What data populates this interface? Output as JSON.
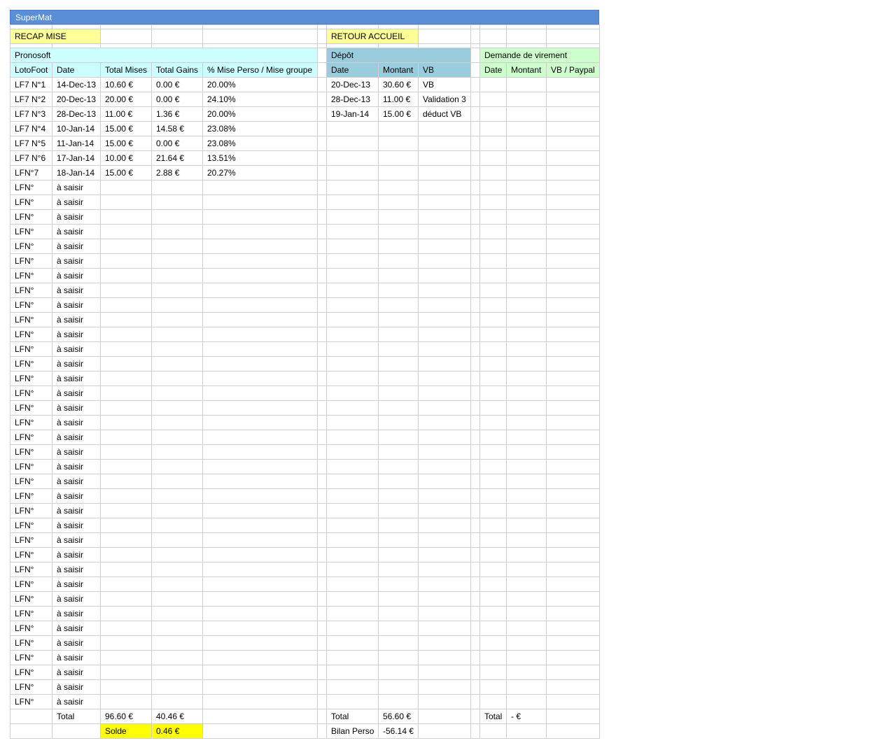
{
  "title": "SuperMat",
  "buttons": {
    "recap": "RECAP MISE",
    "retour": "RETOUR ACCUEIL"
  },
  "sections": {
    "pronosoft": "Pronosoft",
    "depot": "Dépôt",
    "virement": "Demande de virement"
  },
  "headers": {
    "pronosoft": [
      "LotoFoot",
      "Date",
      "Total Mises",
      "Total Gains",
      "% Mise Perso / Mise groupe"
    ],
    "depot": [
      "Date",
      "Montant",
      "VB"
    ],
    "virement": [
      "Date",
      "Montant",
      "VB / Paypal"
    ]
  },
  "rows": [
    {
      "lf": "LF7 N°1",
      "date": "14-Dec-13",
      "mises": "10.60 €",
      "gains": "0.00 €",
      "pct": "20.00%"
    },
    {
      "lf": "LF7 N°2",
      "date": "20-Dec-13",
      "mises": "20.00 €",
      "gains": "0.00 €",
      "pct": "24.10%"
    },
    {
      "lf": "LF7 N°3",
      "date": "28-Dec-13",
      "mises": "11.00 €",
      "gains": "1.36 €",
      "pct": "20.00%"
    },
    {
      "lf": "LF7 N°4",
      "date": "10-Jan-14",
      "mises": "15.00 €",
      "gains": "14.58 €",
      "pct": "23.08%"
    },
    {
      "lf": "LF7 N°5",
      "date": "11-Jan-14",
      "mises": "15.00 €",
      "gains": "0.00 €",
      "pct": "23.08%"
    },
    {
      "lf": "LF7 N°6",
      "date": "17-Jan-14",
      "mises": "10.00 €",
      "gains": "21.64 €",
      "pct": "13.51%"
    },
    {
      "lf": "LFN°7",
      "date": "18-Jan-14",
      "mises": "15.00 €",
      "gains": "2.88 €",
      "pct": "20.27%"
    },
    {
      "lf": "LFN°",
      "date": "à saisir",
      "mises": "",
      "gains": "",
      "pct": ""
    },
    {
      "lf": "LFN°",
      "date": "à saisir",
      "mises": "",
      "gains": "",
      "pct": ""
    },
    {
      "lf": "LFN°",
      "date": "à saisir",
      "mises": "",
      "gains": "",
      "pct": ""
    },
    {
      "lf": "LFN°",
      "date": "à saisir",
      "mises": "",
      "gains": "",
      "pct": ""
    },
    {
      "lf": "LFN°",
      "date": "à saisir",
      "mises": "",
      "gains": "",
      "pct": ""
    },
    {
      "lf": "LFN°",
      "date": "à saisir",
      "mises": "",
      "gains": "",
      "pct": ""
    },
    {
      "lf": "LFN°",
      "date": "à saisir",
      "mises": "",
      "gains": "",
      "pct": ""
    },
    {
      "lf": "LFN°",
      "date": "à saisir",
      "mises": "",
      "gains": "",
      "pct": ""
    },
    {
      "lf": "LFN°",
      "date": "à saisir",
      "mises": "",
      "gains": "",
      "pct": ""
    },
    {
      "lf": "LFN°",
      "date": "à saisir",
      "mises": "",
      "gains": "",
      "pct": ""
    },
    {
      "lf": "LFN°",
      "date": "à saisir",
      "mises": "",
      "gains": "",
      "pct": ""
    },
    {
      "lf": "LFN°",
      "date": "à saisir",
      "mises": "",
      "gains": "",
      "pct": ""
    },
    {
      "lf": "LFN°",
      "date": "à saisir",
      "mises": "",
      "gains": "",
      "pct": ""
    },
    {
      "lf": "LFN°",
      "date": "à saisir",
      "mises": "",
      "gains": "",
      "pct": ""
    },
    {
      "lf": "LFN°",
      "date": "à saisir",
      "mises": "",
      "gains": "",
      "pct": ""
    },
    {
      "lf": "LFN°",
      "date": "à saisir",
      "mises": "",
      "gains": "",
      "pct": ""
    },
    {
      "lf": "LFN°",
      "date": "à saisir",
      "mises": "",
      "gains": "",
      "pct": ""
    },
    {
      "lf": "LFN°",
      "date": "à saisir",
      "mises": "",
      "gains": "",
      "pct": ""
    },
    {
      "lf": "LFN°",
      "date": "à saisir",
      "mises": "",
      "gains": "",
      "pct": ""
    },
    {
      "lf": "LFN°",
      "date": "à saisir",
      "mises": "",
      "gains": "",
      "pct": ""
    },
    {
      "lf": "LFN°",
      "date": "à saisir",
      "mises": "",
      "gains": "",
      "pct": ""
    },
    {
      "lf": "LFN°",
      "date": "à saisir",
      "mises": "",
      "gains": "",
      "pct": ""
    },
    {
      "lf": "LFN°",
      "date": "à saisir",
      "mises": "",
      "gains": "",
      "pct": ""
    },
    {
      "lf": "LFN°",
      "date": "à saisir",
      "mises": "",
      "gains": "",
      "pct": ""
    },
    {
      "lf": "LFN°",
      "date": "à saisir",
      "mises": "",
      "gains": "",
      "pct": ""
    },
    {
      "lf": "LFN°",
      "date": "à saisir",
      "mises": "",
      "gains": "",
      "pct": ""
    },
    {
      "lf": "LFN°",
      "date": "à saisir",
      "mises": "",
      "gains": "",
      "pct": ""
    },
    {
      "lf": "LFN°",
      "date": "à saisir",
      "mises": "",
      "gains": "",
      "pct": ""
    },
    {
      "lf": "LFN°",
      "date": "à saisir",
      "mises": "",
      "gains": "",
      "pct": ""
    },
    {
      "lf": "LFN°",
      "date": "à saisir",
      "mises": "",
      "gains": "",
      "pct": ""
    },
    {
      "lf": "LFN°",
      "date": "à saisir",
      "mises": "",
      "gains": "",
      "pct": ""
    },
    {
      "lf": "LFN°",
      "date": "à saisir",
      "mises": "",
      "gains": "",
      "pct": ""
    },
    {
      "lf": "LFN°",
      "date": "à saisir",
      "mises": "",
      "gains": "",
      "pct": ""
    },
    {
      "lf": "LFN°",
      "date": "à saisir",
      "mises": "",
      "gains": "",
      "pct": ""
    },
    {
      "lf": "LFN°",
      "date": "à saisir",
      "mises": "",
      "gains": "",
      "pct": ""
    },
    {
      "lf": "LFN°",
      "date": "à saisir",
      "mises": "",
      "gains": "",
      "pct": ""
    }
  ],
  "depot_rows": [
    {
      "date": "20-Dec-13",
      "montant": "30.60 €",
      "vb": "VB"
    },
    {
      "date": "28-Dec-13",
      "montant": "11.00 €",
      "vb": "Validation 3"
    },
    {
      "date": "19-Jan-14",
      "montant": "15.00 €",
      "vb": "déduct VB"
    }
  ],
  "totals": {
    "label": "Total",
    "mises": "96.60 €",
    "gains": "40.46 €",
    "solde_label": "Solde",
    "solde": "0.46 €",
    "depot_label": "Total",
    "depot": "56.60 €",
    "bilan_label": "Bilan Perso",
    "bilan": "-56.14 €",
    "virement_label": "Total",
    "virement": " - €"
  },
  "colors": {
    "title_bar": "#5a8ed6",
    "yellow": "#ffff99",
    "cyan": "#ccffff",
    "depot_blue": "#99ccdd",
    "green": "#ccffcc",
    "solde": "#ffff00"
  }
}
